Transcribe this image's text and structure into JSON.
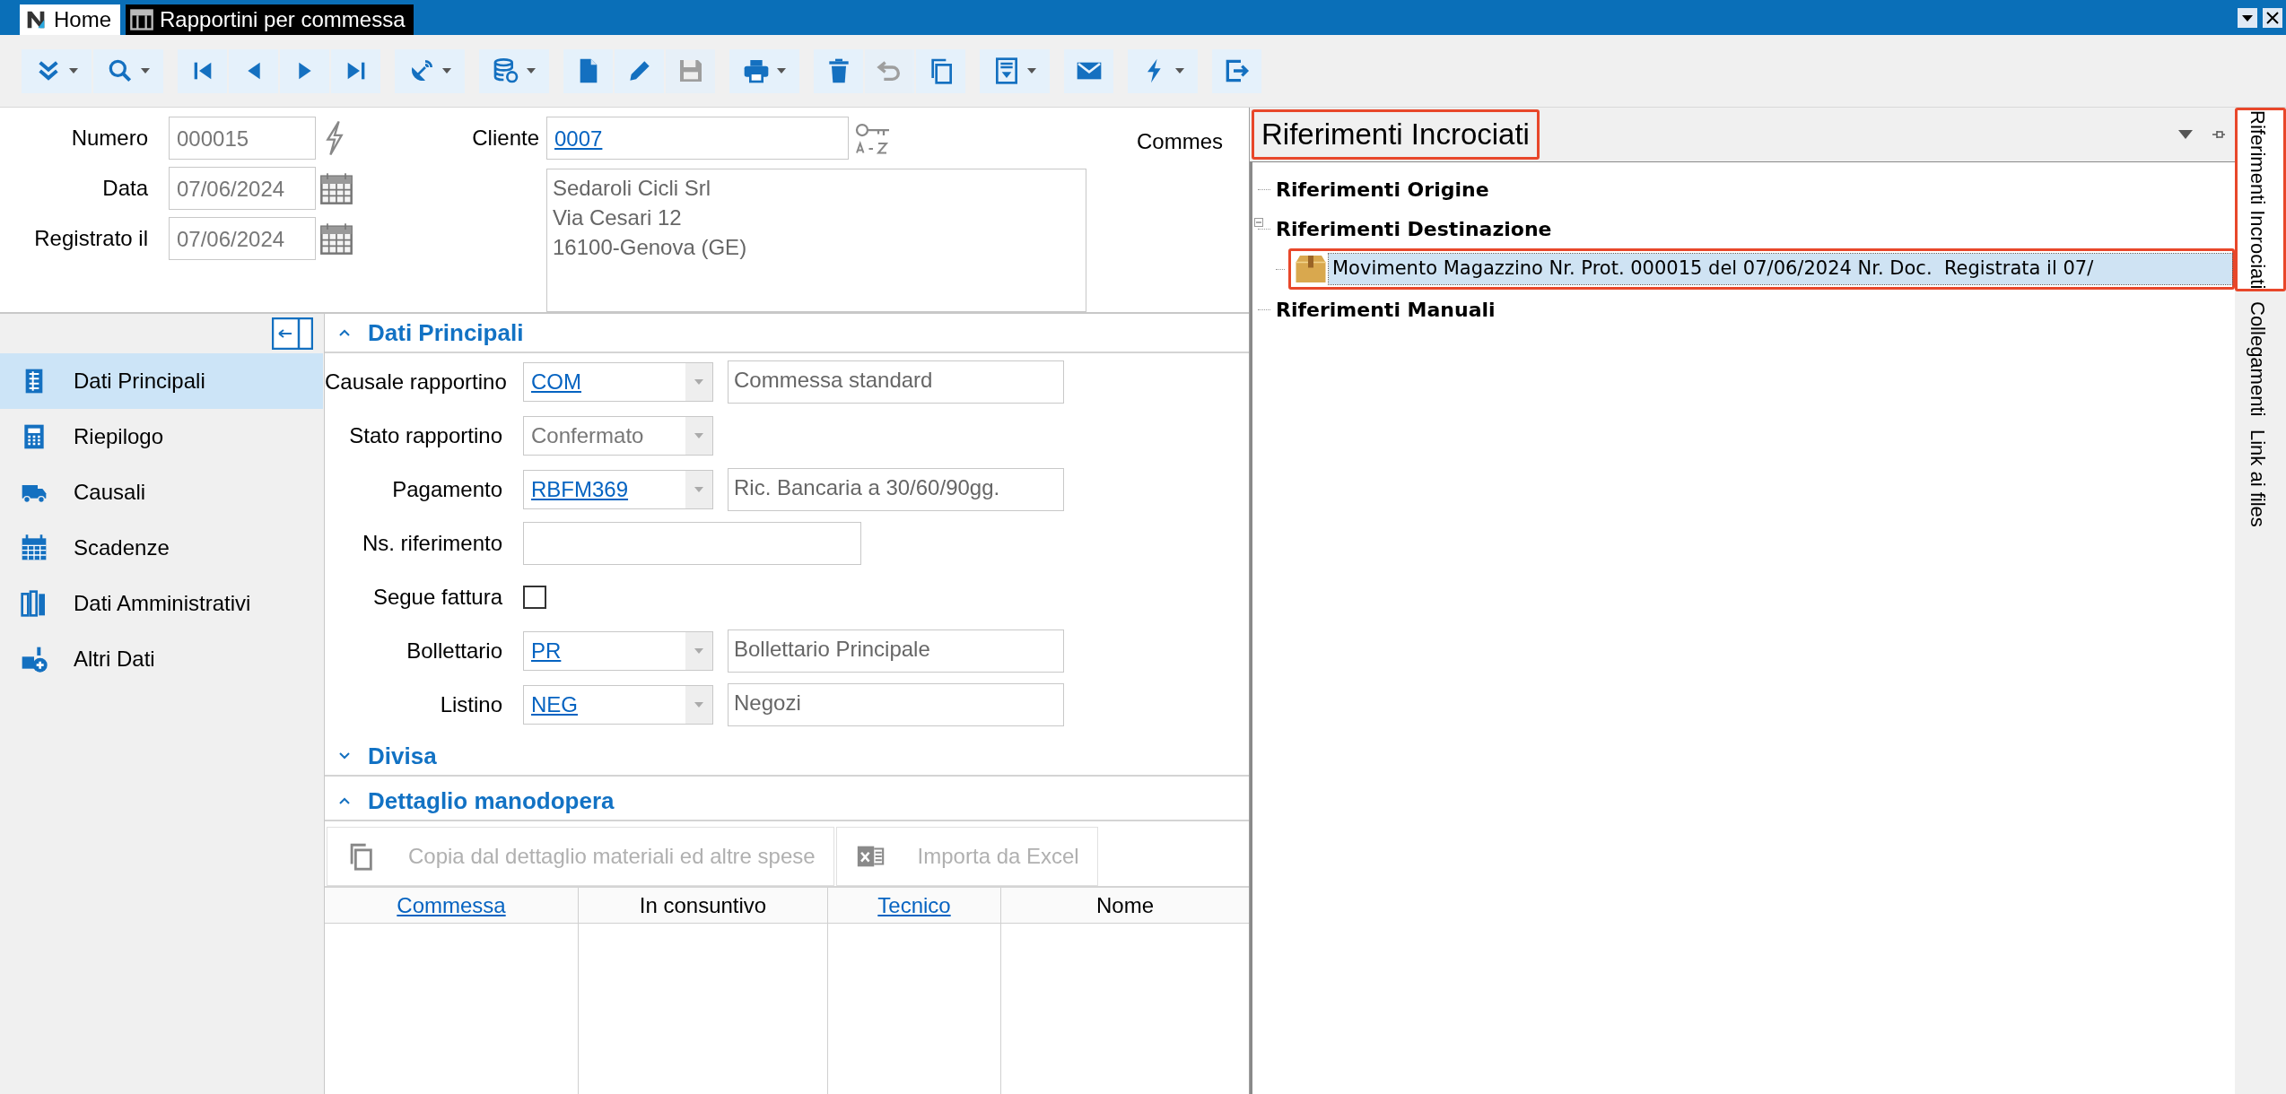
{
  "title_bar": {
    "tabs": [
      {
        "label": "Home",
        "selected": false
      },
      {
        "label": "Rapportini per commessa",
        "selected": true
      }
    ]
  },
  "toolbar": {
    "buttons": [
      {
        "dropdown": true,
        "disabled": false
      },
      {
        "dropdown": true,
        "disabled": false
      },
      {
        "dropdown": false,
        "disabled": false
      },
      {
        "dropdown": false,
        "disabled": false
      },
      {
        "dropdown": false,
        "disabled": false
      },
      {
        "dropdown": false,
        "disabled": false
      },
      {
        "dropdown": true,
        "disabled": false
      },
      {
        "dropdown": true,
        "disabled": false
      },
      {
        "dropdown": false,
        "disabled": false
      },
      {
        "dropdown": false,
        "disabled": false
      },
      {
        "dropdown": false,
        "disabled": true
      },
      {
        "dropdown": true,
        "disabled": false
      },
      {
        "dropdown": false,
        "disabled": false
      },
      {
        "dropdown": false,
        "disabled": true
      },
      {
        "dropdown": false,
        "disabled": false
      },
      {
        "dropdown": true,
        "disabled": false
      },
      {
        "dropdown": false,
        "disabled": false
      },
      {
        "dropdown": true,
        "disabled": false
      },
      {
        "dropdown": false,
        "disabled": false
      }
    ]
  },
  "header": {
    "numero": {
      "label": "Numero",
      "value": "000015"
    },
    "data": {
      "label": "Data",
      "value": "07/06/2024"
    },
    "registrato": {
      "label": "Registrato il",
      "value": "07/06/2024"
    },
    "cliente": {
      "label": "Cliente",
      "value": "0007",
      "address": [
        "Sedaroli Cicli Srl",
        "Via Cesari 12",
        "16100-Genova (GE)"
      ]
    },
    "commessa_label": "Commes"
  },
  "nav": {
    "items": [
      {
        "label": "Dati Principali",
        "selected": true
      },
      {
        "label": "Riepilogo",
        "selected": false
      },
      {
        "label": "Causali",
        "selected": false
      },
      {
        "label": "Scadenze",
        "selected": false
      },
      {
        "label": "Dati Amministrativi",
        "selected": false
      },
      {
        "label": "Altri Dati",
        "selected": false
      }
    ]
  },
  "sections": [
    {
      "title": "Dati Principali",
      "expanded": true
    },
    {
      "title": "Divisa",
      "expanded": false
    },
    {
      "title": "Dettaglio manodopera",
      "expanded": true
    }
  ],
  "fields": [
    {
      "kind": "lookup",
      "label": "Causale rapportino",
      "value": "COM",
      "description": "Commessa standard"
    },
    {
      "kind": "select",
      "label": "Stato rapportino",
      "value": "Confermato"
    },
    {
      "kind": "lookup",
      "label": "Pagamento",
      "value": "RBFM369",
      "description": "Ric. Bancaria a 30/60/90gg."
    },
    {
      "kind": "text",
      "label": "Ns. riferimento"
    },
    {
      "kind": "checkbox",
      "label": "Segue fattura",
      "checked": false
    },
    {
      "kind": "lookup",
      "label": "Bollettario",
      "value": "PR",
      "description": "Bollettario Principale"
    },
    {
      "kind": "lookup",
      "label": "Listino",
      "value": "NEG",
      "description": "Negozi"
    }
  ],
  "detail_actions": [
    {
      "label": "Copia dal dettaglio materiali ed altre spese",
      "disabled": true
    },
    {
      "label": "Importa da Excel",
      "disabled": true
    }
  ],
  "table": {
    "columns": [
      {
        "label": "Commessa",
        "link": true
      },
      {
        "label": "In consuntivo",
        "link": false
      },
      {
        "label": "Tecnico",
        "link": true
      },
      {
        "label": "Nome",
        "link": false
      }
    ]
  },
  "panel": {
    "title": "Riferimenti Incrociati",
    "highlighted": true,
    "tree": [
      {
        "label": "Riferimenti Origine"
      },
      {
        "label": "Riferimenti Destinazione",
        "expanded": true,
        "children": [
          {
            "label": "Movimento Magazzino Nr. Prot. 000015 del 07/06/2024 Nr. Doc.  Registrata il 07/",
            "selected": true,
            "highlighted": true
          }
        ]
      },
      {
        "label": "Riferimenti Manuali"
      }
    ]
  },
  "side_tabs": [
    {
      "label": "Riferimenti Incrociati",
      "selected": true,
      "highlighted": true
    },
    {
      "label": "Collegamenti",
      "selected": false,
      "highlighted": false
    },
    {
      "label": "Link ai files",
      "selected": false,
      "highlighted": false
    }
  ]
}
